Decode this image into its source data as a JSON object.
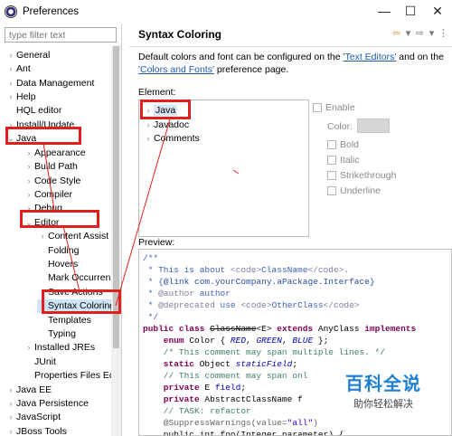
{
  "window": {
    "title": "Preferences",
    "minimize": "—",
    "maximize": "☐",
    "close": "✕"
  },
  "filter": {
    "placeholder": "type filter text"
  },
  "tree": [
    {
      "label": "General",
      "arrow": "›"
    },
    {
      "label": "Ant",
      "arrow": "›"
    },
    {
      "label": "Data Management",
      "arrow": "›"
    },
    {
      "label": "Help",
      "arrow": "›"
    },
    {
      "label": "HQL editor",
      "arrow": ""
    },
    {
      "label": "Install/Update",
      "arrow": "›"
    },
    {
      "label": "Java",
      "arrow": "⌄"
    },
    {
      "label": "Appearance",
      "arrow": "›"
    },
    {
      "label": "Build Path",
      "arrow": "›"
    },
    {
      "label": "Code Style",
      "arrow": "›"
    },
    {
      "label": "Compiler",
      "arrow": "›"
    },
    {
      "label": "Debug",
      "arrow": "›"
    },
    {
      "label": "Editor",
      "arrow": "⌄"
    },
    {
      "label": "Content Assist",
      "arrow": "›"
    },
    {
      "label": "Folding",
      "arrow": ""
    },
    {
      "label": "Hovers",
      "arrow": ""
    },
    {
      "label": "Mark Occurren",
      "arrow": ""
    },
    {
      "label": "Save Actions",
      "arrow": ""
    },
    {
      "label": "Syntax Coloring",
      "arrow": ""
    },
    {
      "label": "Templates",
      "arrow": ""
    },
    {
      "label": "Typing",
      "arrow": ""
    },
    {
      "label": "Installed JREs",
      "arrow": "›"
    },
    {
      "label": "JUnit",
      "arrow": ""
    },
    {
      "label": "Properties Files Ed",
      "arrow": ""
    },
    {
      "label": "Java EE",
      "arrow": "›"
    },
    {
      "label": "Java Persistence",
      "arrow": "›"
    },
    {
      "label": "JavaScript",
      "arrow": "›"
    },
    {
      "label": "JBoss Tools",
      "arrow": "›"
    }
  ],
  "page": {
    "title": "Syntax Coloring",
    "desc_prefix": "Default colors and font can be configured on the ",
    "link1": "'Text Editors'",
    "desc_mid": " and on the ",
    "link2": "'Colors and Fonts'",
    "desc_suffix": " preference page.",
    "element_label": "Element:",
    "elements": [
      {
        "label": "Java",
        "arrow": "›"
      },
      {
        "label": "Javadoc",
        "arrow": "›"
      },
      {
        "label": "Comments",
        "arrow": "›"
      }
    ],
    "enable": "Enable",
    "color": "Color:",
    "bold": "Bold",
    "italic": "Italic",
    "strikethrough": "Strikethrough",
    "underline": "Underline",
    "preview_label": "Preview:"
  },
  "nav": {
    "back": "⇦",
    "back_menu": "▾",
    "forward": "⇨",
    "forward_menu": "▾",
    "more": "⋮"
  },
  "code": {
    "l1": "/**",
    "l2a": " * This is about ",
    "l2b": "<code>",
    "l2c": "ClassName",
    "l2d": "</code>",
    ".": ".",
    "l2e": ".",
    "l3a": " * {",
    "l3b": "@link",
    "l3c": " com.yourCompany.aPackage.Interface}",
    "l4a": " * ",
    "l4b": "@author",
    "l4c": " author",
    "l5a": " * ",
    "l5b": "@deprecated",
    "l5c": " use ",
    "l5d": "<code>",
    "l5e": "OtherClass",
    "l5f": "</code>",
    "l6": " */",
    "l7a": "public class ",
    "l7b": "ClassName",
    "l7c": "<E> ",
    "l7d": "extends",
    "l7e": " AnyClass ",
    "l7f": "implements",
    "l8a": "    enum ",
    "l8b": "Color { ",
    "l8c": "RED",
    "l8d": ", ",
    "l8e": "GREEN",
    "l8f": ", ",
    "l8g": "BLUE",
    "l8h": " };",
    "l9": "    /* This comment may span multiple lines. */",
    "l10a": "    static ",
    "l10b": "Object ",
    "l10c": "staticField",
    ";": ";",
    "l10d": ";",
    "l11": "    // This comment may span onl",
    "l12a": "    private ",
    "l12b": "E ",
    "l12c": "field",
    "l12d": ";",
    "l13a": "    private ",
    "l13b": "AbstractClassName f",
    "l14": "    // TASK: refactor",
    "l15a": "    @SuppressWarnings(value=",
    "l15b": "\"all\"",
    "l15c": ")",
    "l16": "    public int foo(Integer parameter) {"
  },
  "watermark": {
    "line1": "百科全说",
    "line2": "助你轻松解决"
  },
  "colors": {
    "annotation_red": "#e0201f",
    "link": "#1f5aa8",
    "selection": "#cfe4f7"
  }
}
